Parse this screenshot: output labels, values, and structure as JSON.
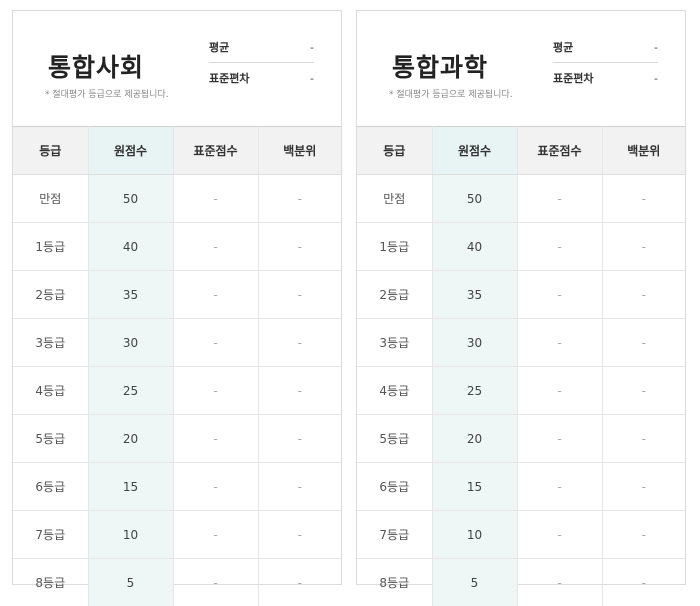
{
  "panels": [
    {
      "subject": "통합사회",
      "note": "* 절대평가 등급으로 제공됩니다.",
      "stats": [
        {
          "label": "평균",
          "value": "-"
        },
        {
          "label": "표준편차",
          "value": "-"
        }
      ],
      "columns": [
        "등급",
        "원점수",
        "표준점수",
        "백분위"
      ],
      "rows": [
        [
          "만점",
          "50",
          "-",
          "-"
        ],
        [
          "1등급",
          "40",
          "-",
          "-"
        ],
        [
          "2등급",
          "35",
          "-",
          "-"
        ],
        [
          "3등급",
          "30",
          "-",
          "-"
        ],
        [
          "4등급",
          "25",
          "-",
          "-"
        ],
        [
          "5등급",
          "20",
          "-",
          "-"
        ],
        [
          "6등급",
          "15",
          "-",
          "-"
        ],
        [
          "7등급",
          "10",
          "-",
          "-"
        ],
        [
          "8등급",
          "5",
          "-",
          "-"
        ]
      ]
    },
    {
      "subject": "통합과학",
      "note": "* 절대평가 등급으로 제공됩니다.",
      "stats": [
        {
          "label": "평균",
          "value": "-"
        },
        {
          "label": "표준편차",
          "value": "-"
        }
      ],
      "columns": [
        "등급",
        "원점수",
        "표준점수",
        "백분위"
      ],
      "rows": [
        [
          "만점",
          "50",
          "-",
          "-"
        ],
        [
          "1등급",
          "40",
          "-",
          "-"
        ],
        [
          "2등급",
          "35",
          "-",
          "-"
        ],
        [
          "3등급",
          "30",
          "-",
          "-"
        ],
        [
          "4등급",
          "25",
          "-",
          "-"
        ],
        [
          "5등급",
          "20",
          "-",
          "-"
        ],
        [
          "6등급",
          "15",
          "-",
          "-"
        ],
        [
          "7등급",
          "10",
          "-",
          "-"
        ],
        [
          "8등급",
          "5",
          "-",
          "-"
        ]
      ]
    }
  ],
  "colors": {
    "header_bg": "#f2f2f2",
    "raw_score_column_bg": "#eef6f6",
    "border": "#dcdcdc"
  }
}
